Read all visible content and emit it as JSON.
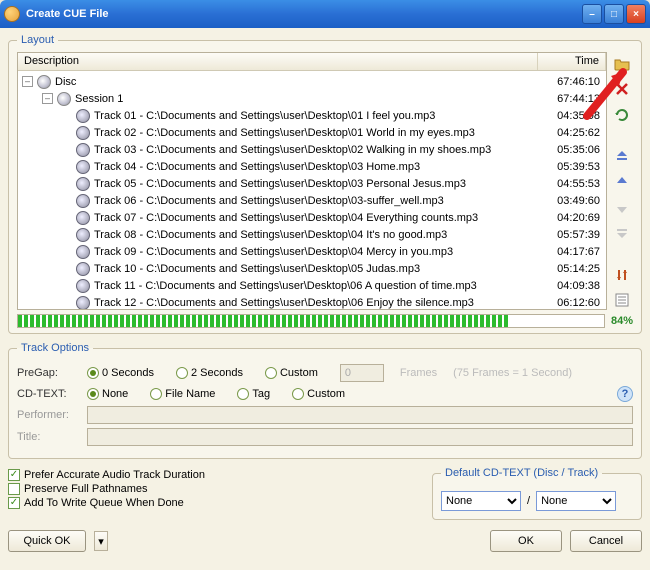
{
  "window": {
    "title": "Create CUE File"
  },
  "layout": {
    "legend": "Layout",
    "columns": {
      "desc": "Description",
      "time": "Time"
    },
    "disc": {
      "label": "Disc",
      "time": "67:46:10"
    },
    "session": {
      "label": "Session 1",
      "time": "67:44:13"
    },
    "tracks": [
      {
        "label": "Track 01 - C:\\Documents and Settings\\user\\Desktop\\01 I feel you.mp3",
        "time": "04:35:08"
      },
      {
        "label": "Track 02 - C:\\Documents and Settings\\user\\Desktop\\01 World in my eyes.mp3",
        "time": "04:25:62"
      },
      {
        "label": "Track 03 - C:\\Documents and Settings\\user\\Desktop\\02 Walking in my shoes.mp3",
        "time": "05:35:06"
      },
      {
        "label": "Track 04 - C:\\Documents and Settings\\user\\Desktop\\03 Home.mp3",
        "time": "05:39:53"
      },
      {
        "label": "Track 05 - C:\\Documents and Settings\\user\\Desktop\\03 Personal Jesus.mp3",
        "time": "04:55:53"
      },
      {
        "label": "Track 06 - C:\\Documents and Settings\\user\\Desktop\\03-suffer_well.mp3",
        "time": "03:49:60"
      },
      {
        "label": "Track 07 - C:\\Documents and Settings\\user\\Desktop\\04 Everything counts.mp3",
        "time": "04:20:69"
      },
      {
        "label": "Track 08 - C:\\Documents and Settings\\user\\Desktop\\04 It's no good.mp3",
        "time": "05:57:39"
      },
      {
        "label": "Track 09 - C:\\Documents and Settings\\user\\Desktop\\04 Mercy in you.mp3",
        "time": "04:17:67"
      },
      {
        "label": "Track 10 - C:\\Documents and Settings\\user\\Desktop\\05 Judas.mp3",
        "time": "05:14:25"
      },
      {
        "label": "Track 11 - C:\\Documents and Settings\\user\\Desktop\\06 A question of time.mp3",
        "time": "04:09:38"
      },
      {
        "label": "Track 12 - C:\\Documents and Settings\\user\\Desktop\\06 Enjoy the silence.mp3",
        "time": "06:12:60"
      }
    ],
    "progress_pct": "84%"
  },
  "options": {
    "legend": "Track Options",
    "pregap": {
      "label": "PreGap:",
      "choices": [
        "0 Seconds",
        "2 Seconds",
        "Custom"
      ],
      "custom_value": "0",
      "frames_label": "Frames",
      "hint": "(75 Frames = 1 Second)"
    },
    "cdtext": {
      "label": "CD-TEXT:",
      "choices": [
        "None",
        "File Name",
        "Tag",
        "Custom"
      ]
    },
    "performer_label": "Performer:",
    "title_label": "Title:"
  },
  "checks": {
    "c1": "Prefer Accurate Audio Track Duration",
    "c2": "Preserve Full Pathnames",
    "c3": "Add To Write Queue When Done"
  },
  "default_cdtext": {
    "legend": "Default CD-TEXT (Disc / Track)",
    "disc_value": "None",
    "slash": "/",
    "track_value": "None"
  },
  "buttons": {
    "quick_ok": "Quick OK",
    "ok": "OK",
    "cancel": "Cancel"
  }
}
